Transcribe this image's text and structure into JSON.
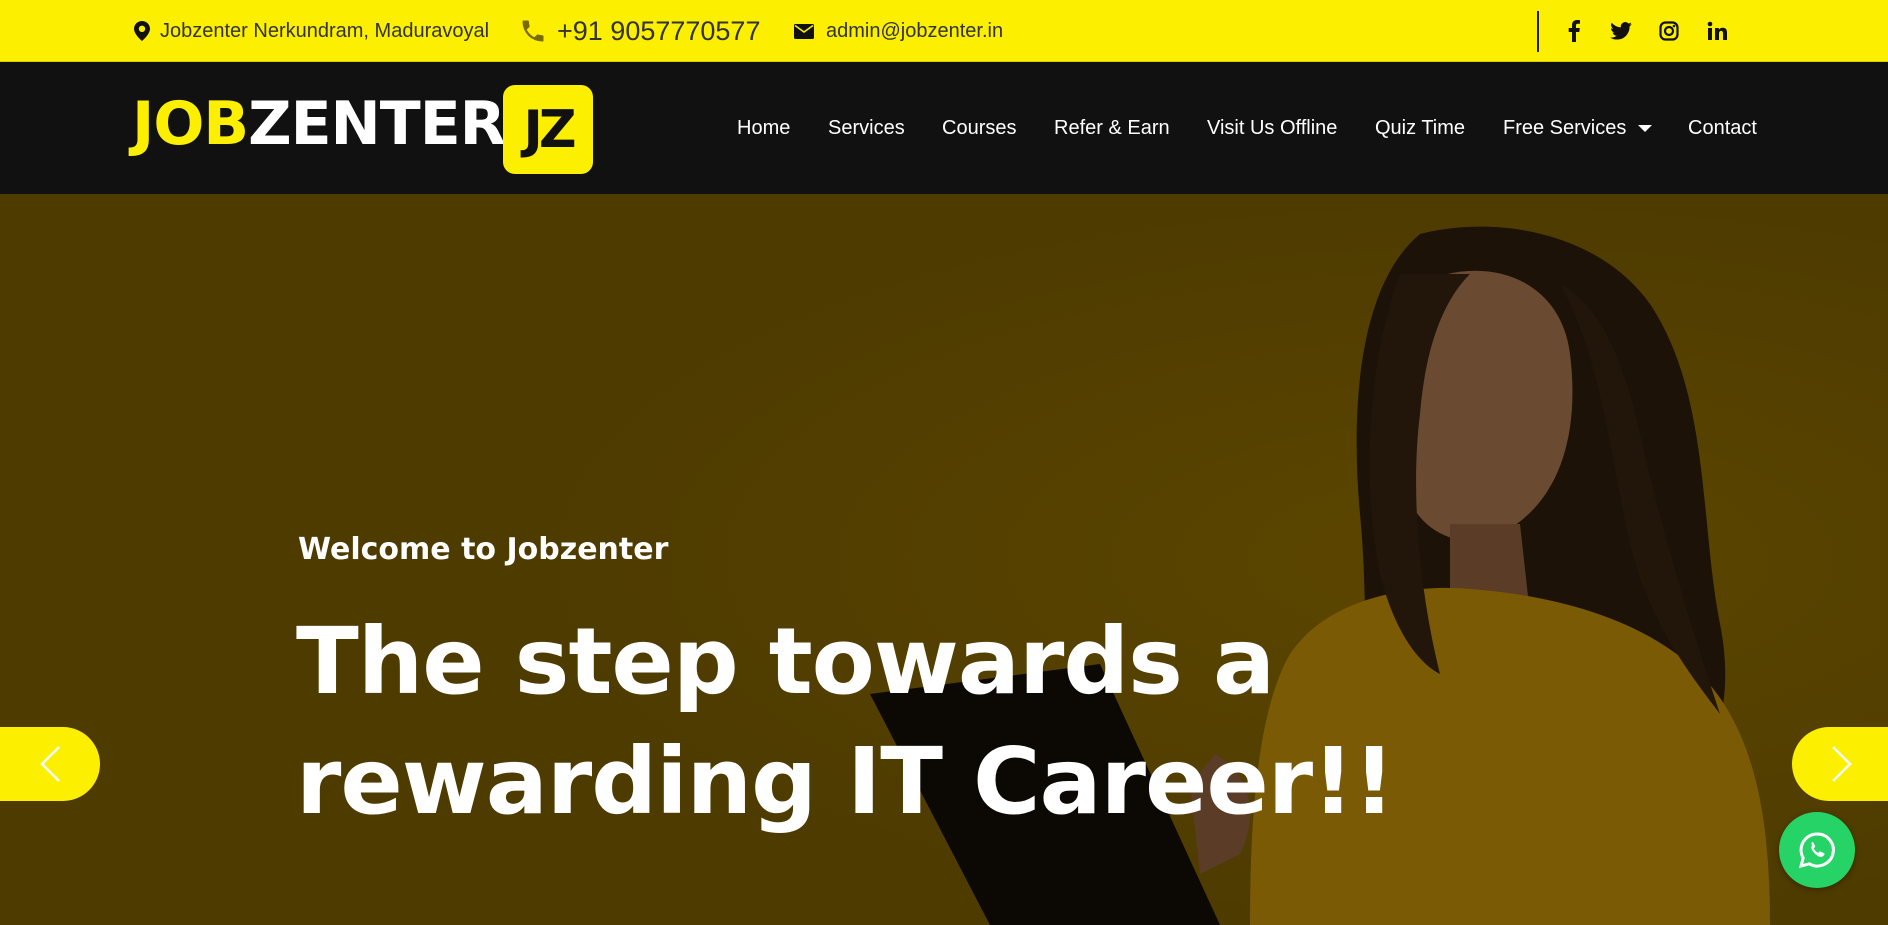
{
  "topbar": {
    "location": "Jobzenter Nerkundram, Maduravoyal",
    "phone": "+91 9057770577",
    "email": "admin@jobzenter.in",
    "social": [
      "facebook-icon",
      "twitter-icon",
      "instagram-icon",
      "linkedin-icon"
    ]
  },
  "brand": {
    "logo_part1": "JOB",
    "logo_part2": "ZENTER",
    "badge": "JZ"
  },
  "nav": {
    "items": [
      "Home",
      "Services",
      "Courses",
      "Refer & Earn",
      "Visit Us Offline",
      "Quiz Time",
      "Free Services",
      "Contact"
    ]
  },
  "hero": {
    "subtitle": "Welcome to Jobzenter",
    "title": "The step towards a rewarding IT Career!!"
  },
  "colors": {
    "accent": "#fcef00",
    "nav_bg": "#111111",
    "hero_overlay": "#4e3b00",
    "whatsapp": "#25d366"
  }
}
